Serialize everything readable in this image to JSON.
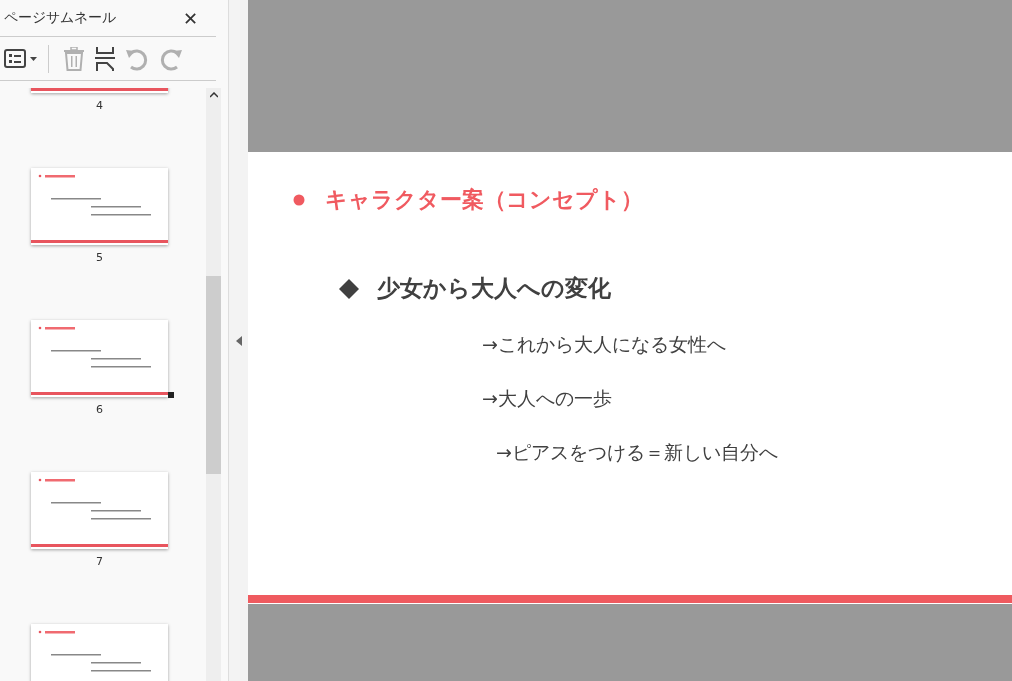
{
  "panel": {
    "title": "ページサムネール",
    "close": "✕"
  },
  "toolbar": [
    {
      "kind": "options",
      "disabled": false
    },
    {
      "kind": "delete",
      "disabled": true
    },
    {
      "kind": "insert",
      "disabled": false
    },
    {
      "kind": "rotate-left",
      "disabled": true
    },
    {
      "kind": "rotate-right",
      "disabled": true
    }
  ],
  "thumbnails": [
    {
      "label": "4",
      "selected": false
    },
    {
      "label": "5",
      "selected": false
    },
    {
      "label": "6",
      "selected": true
    },
    {
      "label": "7",
      "selected": false
    },
    {
      "selected": false
    }
  ],
  "slide": {
    "title": "キャラクター案（コンセプト）",
    "heading": "少女から大人への変化",
    "lines": [
      "→これから大人になる女性へ",
      "→大人への一歩",
      "→ピアスをつける＝新しい自分へ"
    ]
  }
}
